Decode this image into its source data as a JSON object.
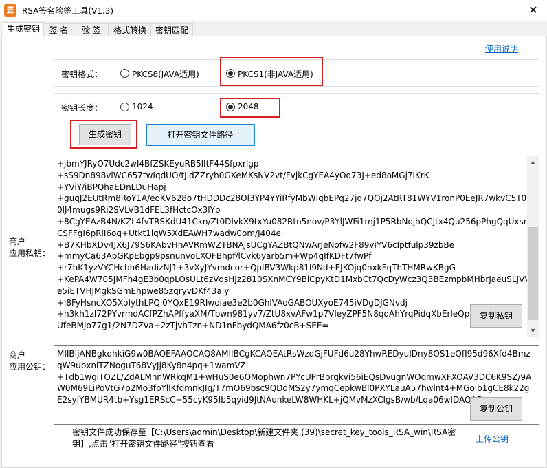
{
  "window": {
    "title": "RSA签名验签工具(V1.3)",
    "close_symbol": "✕",
    "app_icon_glyph": "签"
  },
  "tabs": [
    "生成密钥",
    "签 名",
    "验 签",
    "格式转换",
    "密钥匹配"
  ],
  "help_link": "使用说明",
  "key_format": {
    "label": "密钥格式：",
    "options": [
      "PKCS8(JAVA适用)",
      "PKCS1(非JAVA适用)"
    ],
    "selected": "PKCS1(非JAVA适用)"
  },
  "key_length": {
    "label": "密钥长度：",
    "options": [
      "1024",
      "2048"
    ],
    "selected": "2048"
  },
  "buttons": {
    "generate": "生成密钥",
    "open_path": "打开密钥文件路径",
    "copy_private": "复制私钥",
    "copy_public": "复制公钥"
  },
  "private_key": {
    "label_line1": "商户",
    "label_line2": "应用私钥：",
    "lines": [
      "+jbmYJRyO7Udc2wI4BfZSKEyuRB5lItF44Sfpxrlgp",
      "+sS9Dn898vlWC657twIqdUO/tJidZZryh0GXeMKsNV2vt/FvjkCgYEA4yOq73J+ed8oMGj7lKrK",
      "+YViY/iBPQhaEDnLDuHapj",
      "+guqJ2EUtRm8RoY1A/eoKV628o7tHDDDc28Ol3YP4YYiRfyMbWIqbEPq27jq7QOj2AtRT81WYV1ronP0EeJR7wkvC5T09",
      "0lJ4mugs9Ri2SVLVB1dFEL3fHctcOx3lYp",
      "+8CgYEAzB4N/KZL4fvTRSKdU41Ckn/Zt0DIvkX9txYu082Rtn5nov/P3YlJWFi1rnj1P5RbNojhQCJtx4Qu256pPhgQqUxsr7",
      "CSFFgI6pRlI6oq+Utkt1lqW5XdEAWH7wadw0om/J404e",
      "+B7KHbXDv4JX6J79S6KAbvHnAVRmWZTBNAJsUCgYAZBtQNwArJeNofw2F89viYV6cIptfulp39zbBe",
      "+mmyCa63AbGKpEbgp9psnunvoLXOFBhpf/lCvk6yarb5m+Wp4qIfKDFt7fwPf",
      "+r7hK1yzVYCHcbh6HadizNJ1+3vXyJYvmdcor+QpIBV3Wkp81l9Nd+EJKOjq0nxkFqThTHMRwKBgG",
      "+KePA4W705JMFh4gE3b0qpLOsULt6zVqsHJz2810SXnMCY9BlCpyKtD1MxbCt7QcDyWcz3Q3BEzmpbMHbrJaeuSLJVV",
      "e5iETVHJMgkSGmEhpwe85zqryvDKf43aly",
      "+l8FyHsncXO5XoIythLPQi0YQxE19RIwoiae3e2b0GhlVAoGABOUXyoE745iVDgDJGNvdj",
      "+h3kh1zI72PYvrmdACfPZhAPffyaXM/Tbwn981yv7/ZtU8xvAFw1p7VIeyZPF5N8qqAhYrqPidqXbErleQpf8epCb",
      "UfeBMJo77g1/2N7DZva+2zTjvhTzn+ND1nFbydQMA6fz0cB+SEE="
    ]
  },
  "public_key": {
    "label_line1": "商户",
    "label_line2": "应用公钥：",
    "lines": [
      "MIIBIjANBgkqhkiG9w0BAQEFAAOCAQ8AMIIBCgKCAQEAtRsWzdGjFUFd6u28YhwREDyuIDny8OS1eQfI95d96Xfd4Bmz",
      "qW9ubxniTZNoguT68VyJj8Ky8n4pq+1wamVZI",
      "+Tdb1wgiTOZL/ZdALMnnWRkqM1+wHuS0e6OMophwn7PYcUPrBbrqkvi56iEQsDvugnWOqmwXFXOAV3DC6K9SZ/9A",
      "W0M69LiPoVtG7p2Mo3fpYllKfdmnkJIg/T7mO69bsc9QDdMS2y7ymqCepkwBl0PXYLauA57hwlnt4+MGoib1gCE8k22g",
      "E2syIYBMUR4tb+Ysg1ERScC+55cyK95Ib5qyid9JtNAunkeLW8WHKL+jQMvMzXCIgsB/wb/Lqa06wIDAQAB"
    ]
  },
  "status": {
    "line1": "密钥文件成功保存至【C:\\Users\\admin\\Desktop\\新建文件夹 (39)\\secret_key_tools_RSA_win\\RSA密",
    "line2": "钥】,点击\"打开密钥文件路径\"按钮查看"
  },
  "upload_link": "上传公钥",
  "colors": {
    "highlight": "#d81e1e",
    "link": "#0066cc",
    "focus": "#1e7fd8"
  }
}
